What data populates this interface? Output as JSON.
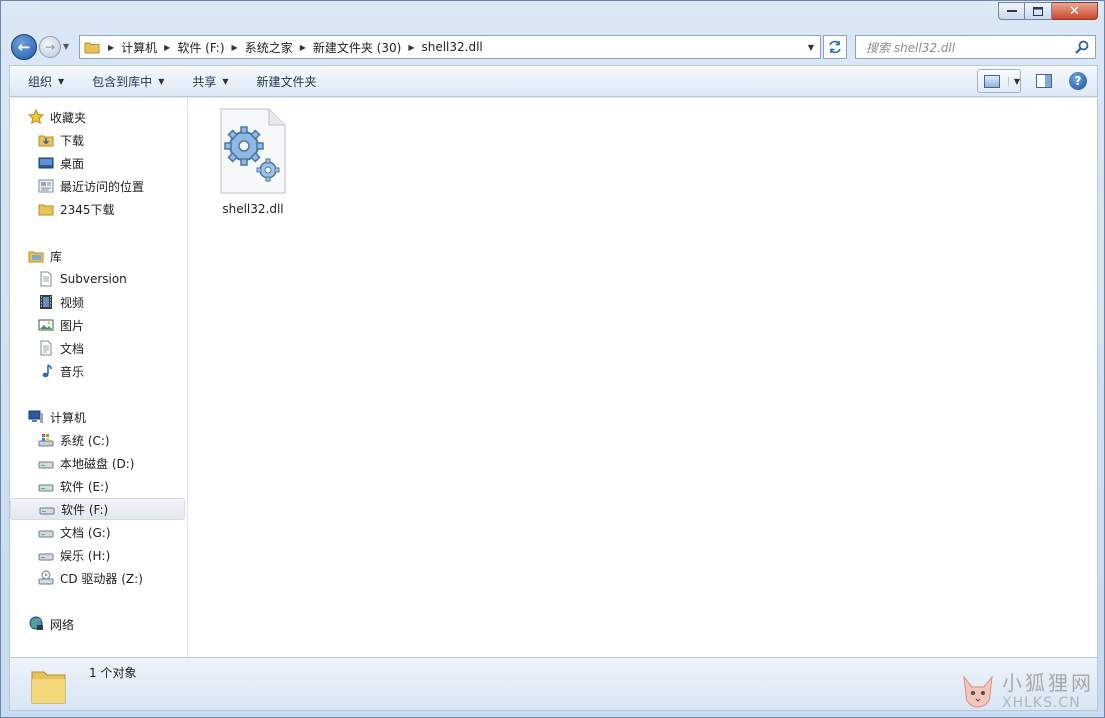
{
  "window": {
    "controls": {
      "minimize": "minimize-icon",
      "maximize": "maximize-icon",
      "close": "close-icon"
    }
  },
  "address": {
    "crumbs": [
      "计算机",
      "软件 (F:)",
      "系统之家",
      "新建文件夹 (30)",
      "shell32.dll"
    ]
  },
  "search": {
    "placeholder": "搜索 shell32.dll"
  },
  "toolbar": {
    "organize": "组织",
    "include_in_library": "包含到库中",
    "share": "共享",
    "new_folder": "新建文件夹"
  },
  "sidebar": {
    "favorites": {
      "header": "收藏夹",
      "items": [
        "下载",
        "桌面",
        "最近访问的位置",
        "2345下载"
      ]
    },
    "libraries": {
      "header": "库",
      "items": [
        "Subversion",
        "视频",
        "图片",
        "文档",
        "音乐"
      ]
    },
    "computer": {
      "header": "计算机",
      "items": [
        "系统 (C:)",
        "本地磁盘 (D:)",
        "软件 (E:)",
        "软件 (F:)",
        "文档 (G:)",
        "娱乐 (H:)",
        "CD 驱动器 (Z:)"
      ],
      "selected": "软件 (F:)"
    },
    "network": {
      "header": "网络"
    }
  },
  "files": [
    {
      "name": "shell32.dll",
      "icon": "dll-gear-icon"
    }
  ],
  "status": {
    "count": "1 个对象"
  },
  "watermark": {
    "cn": "小狐狸网",
    "en": "XHLKS.CN"
  },
  "colors": {
    "accent": "#2a6ab0",
    "selection": "#e3e8ef",
    "window_frame": "#c7daf0"
  }
}
